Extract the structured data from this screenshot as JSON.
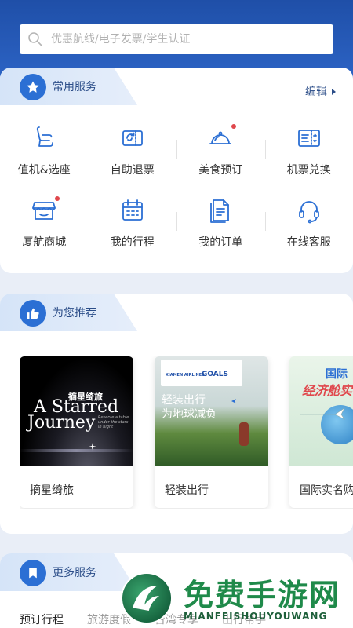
{
  "search": {
    "placeholder": "优惠航线/电子发票/学生认证"
  },
  "common_services": {
    "title": "常用服务",
    "edit_label": "编辑",
    "items": [
      {
        "label": "值机&选座",
        "icon": "seat-icon",
        "badge": false
      },
      {
        "label": "自助退票",
        "icon": "refund-ticket-icon",
        "badge": false
      },
      {
        "label": "美食预订",
        "icon": "food-cloche-icon",
        "badge": true
      },
      {
        "label": "机票兑换",
        "icon": "ticket-exchange-icon",
        "badge": false
      },
      {
        "label": "厦航商城",
        "icon": "shop-icon",
        "badge": true
      },
      {
        "label": "我的行程",
        "icon": "calendar-icon",
        "badge": false
      },
      {
        "label": "我的订单",
        "icon": "order-document-icon",
        "badge": false
      },
      {
        "label": "在线客服",
        "icon": "headset-icon",
        "badge": false
      }
    ]
  },
  "recommend": {
    "title": "为您推荐",
    "cards": [
      {
        "caption": "摘星绮旅",
        "image_title_cn": "摘星绮旅",
        "image_title_en_1": "A Starred",
        "image_title_en_2": "Journey",
        "image_subtitle": "Reserve a table under the stars in flight"
      },
      {
        "caption": "轻装出行",
        "image_line_1": "轻装出行",
        "image_line_2": "为地球减负",
        "image_badge": "GOALS",
        "image_brand": "XIAMEN AIRLINES"
      },
      {
        "caption": "国际实名购",
        "image_line_1": "国际",
        "image_line_2": "经济舱实"
      }
    ]
  },
  "more_services": {
    "title": "更多服务",
    "tabs": [
      "预订行程",
      "旅游度假",
      "台湾专享",
      "出行帮手"
    ]
  },
  "watermark": {
    "text": "免费手游网",
    "sub": "MIANFEISHOUYOUWANG"
  },
  "colors": {
    "primary": "#2b6fd4",
    "header_dark": "#1f4fa8",
    "badge_red": "#e0474c"
  }
}
